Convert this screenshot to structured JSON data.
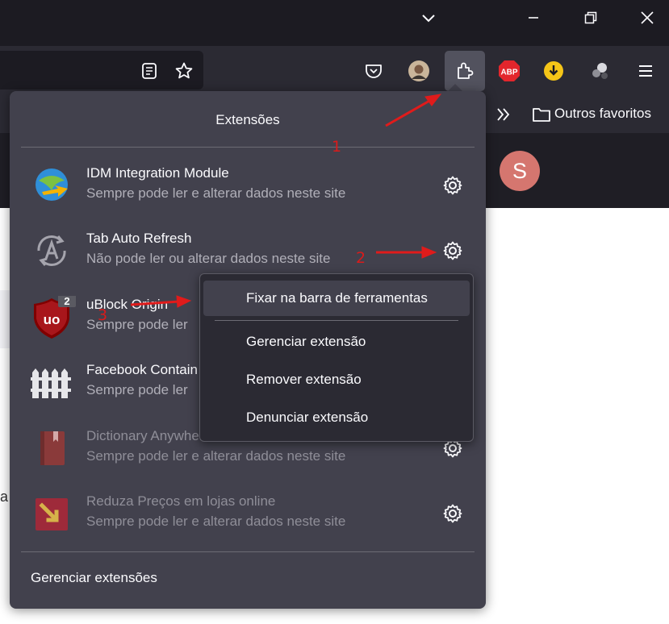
{
  "toolbar": {
    "bookmarks_overflow_icon": "chevrons-right-icon",
    "bookmark_folder_label": "Outros favoritos",
    "icons": [
      "reader-mode-icon",
      "star-icon",
      "pocket-icon",
      "profile-avatar",
      "extensions-puzzle-icon",
      "adblock-plus-icon",
      "download-helper-icon",
      "extension-misc-icon",
      "hamburger-menu-icon"
    ],
    "abp_label": "ABP"
  },
  "window_controls": [
    "chevron-down-icon",
    "minimize-icon",
    "restore-icon",
    "close-icon"
  ],
  "page": {
    "avatar_letter": "S",
    "edge_letter": "a"
  },
  "extensions_panel": {
    "title": "Extensões",
    "items": [
      {
        "name": "IDM Integration Module",
        "desc": "Sempre pode ler e alterar dados neste site",
        "icon": "idm-globe-icon",
        "dimmed": false
      },
      {
        "name": "Tab Auto Refresh",
        "desc": "Não pode ler ou alterar dados neste site",
        "icon": "tab-auto-refresh-icon",
        "dimmed": false
      },
      {
        "name": "uBlock Origin",
        "desc": "Sempre pode ler",
        "icon": "ublock-origin-icon",
        "badge": "2",
        "dimmed": false
      },
      {
        "name": "Facebook Contain",
        "desc": "Sempre pode ler",
        "icon": "facebook-container-fence-icon",
        "dimmed": false
      },
      {
        "name": "Dictionary Anywhere",
        "desc": "Sempre pode ler e alterar dados neste site",
        "icon": "dictionary-book-icon",
        "dimmed": true
      },
      {
        "name": "Reduza Preços em lojas online",
        "desc": "Sempre pode ler e alterar dados neste site",
        "icon": "reduza-precos-icon",
        "dimmed": true
      }
    ],
    "manage_label": "Gerenciar extensões"
  },
  "context_menu": {
    "items": [
      "Fixar na barra de ferramentas",
      "Gerenciar extensão",
      "Remover extensão",
      "Denunciar extensão"
    ],
    "hovered_index": 0
  },
  "annotations": {
    "labels": [
      "1",
      "2",
      "3"
    ],
    "color": "#d91b1b"
  }
}
